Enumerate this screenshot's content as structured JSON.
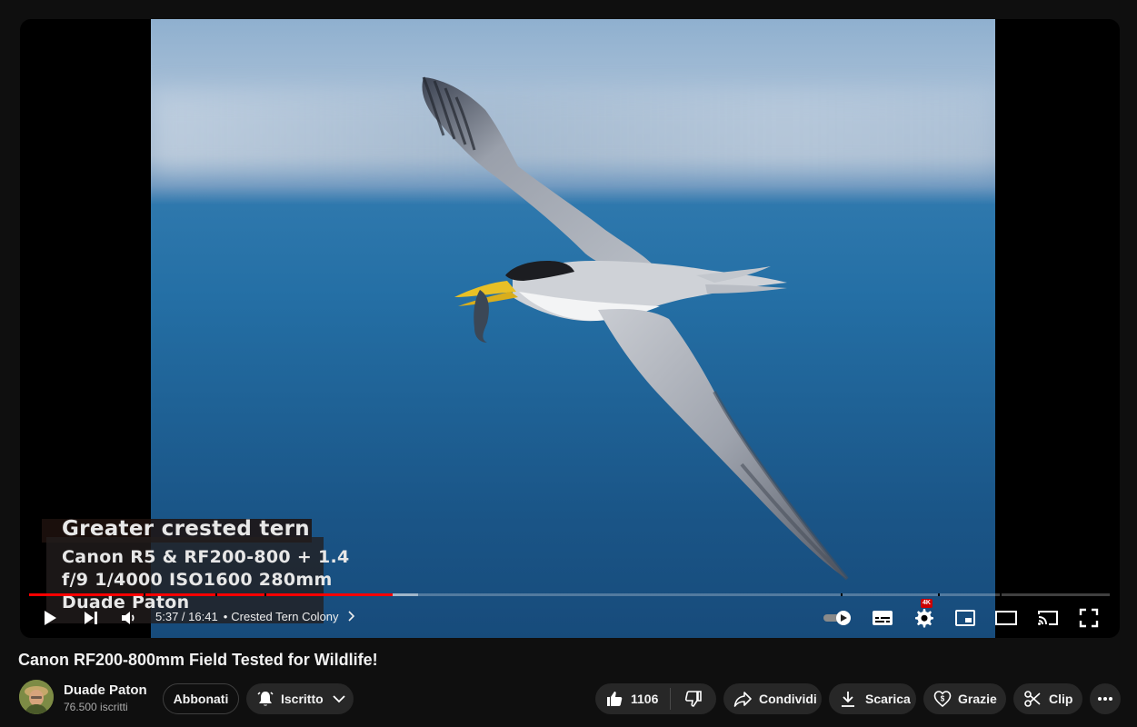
{
  "video": {
    "title": "Canon RF200-800mm Field Tested for Wildlife!",
    "captions": {
      "species": "Greater crested tern",
      "line1": "Canon R5 & RF200-800 + 1.4",
      "line2": "f/9 1/4000 ISO1600 280mm",
      "line3": "Duade Paton"
    }
  },
  "player": {
    "current_time": "5:37",
    "time_separator": " / ",
    "duration": "16:41",
    "chapter_dot": "•",
    "chapter": "Crested Tern Colony",
    "played_fraction": 0.3367,
    "buffered_fraction": 0.36,
    "quality_badge": "4K",
    "autoplay_on": true,
    "icons": [
      "play-icon",
      "next-icon",
      "volume-icon",
      "autoplay-toggle",
      "subtitles-icon",
      "settings-icon",
      "miniplayer-icon",
      "theater-icon",
      "cast-icon",
      "fullscreen-icon"
    ]
  },
  "channel": {
    "name": "Duade Paton",
    "subscribers": "76.500 iscritti",
    "join_label": "Abbonati",
    "subscribed_label": "Iscritto"
  },
  "actions": {
    "likes": "1106",
    "share": "Condividi",
    "download": "Scarica",
    "thanks": "Grazie",
    "clip": "Clip"
  },
  "colors": {
    "background": "#0f0f0f",
    "progress_played": "#ff0000",
    "pill": "#272727",
    "badge": "#cc0000"
  }
}
